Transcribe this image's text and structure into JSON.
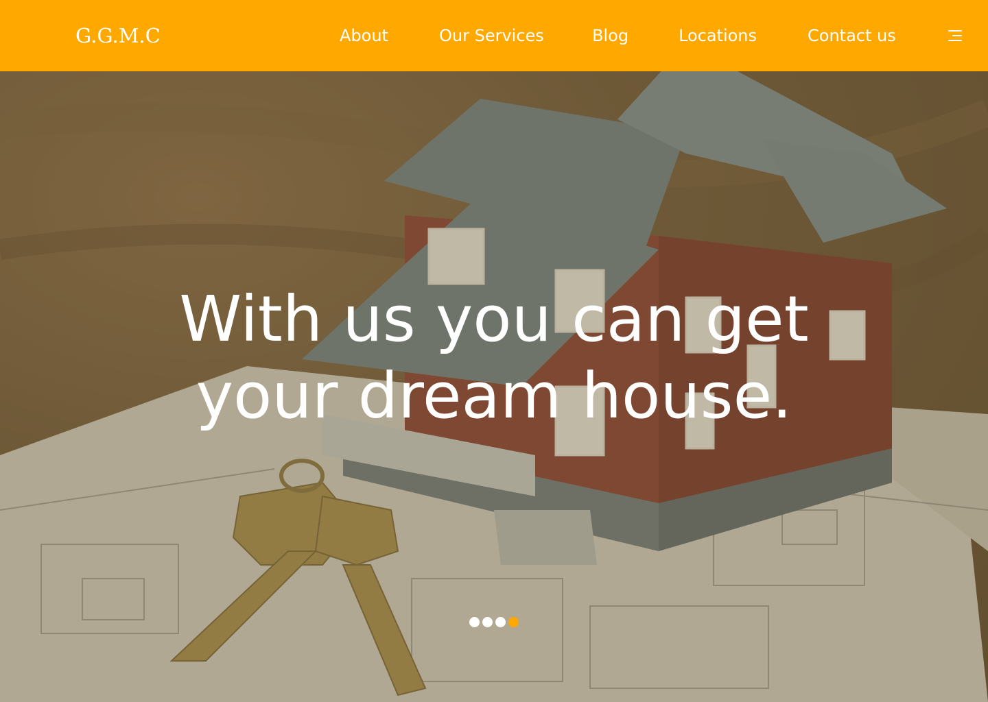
{
  "brand": {
    "logo": "G.G.M.C",
    "accent_color": "#ffa800"
  },
  "nav": {
    "items": [
      {
        "label": "About"
      },
      {
        "label": "Our Services"
      },
      {
        "label": "Blog"
      },
      {
        "label": "Locations"
      },
      {
        "label": "Contact us"
      }
    ],
    "menu_icon": "hamburger-menu-icon"
  },
  "hero": {
    "headline_line1": "With us you can get",
    "headline_line2": "your dream house.",
    "image": "model house with keys on blueprint",
    "carousel": {
      "slide_count": 4,
      "active_index": 3
    }
  }
}
